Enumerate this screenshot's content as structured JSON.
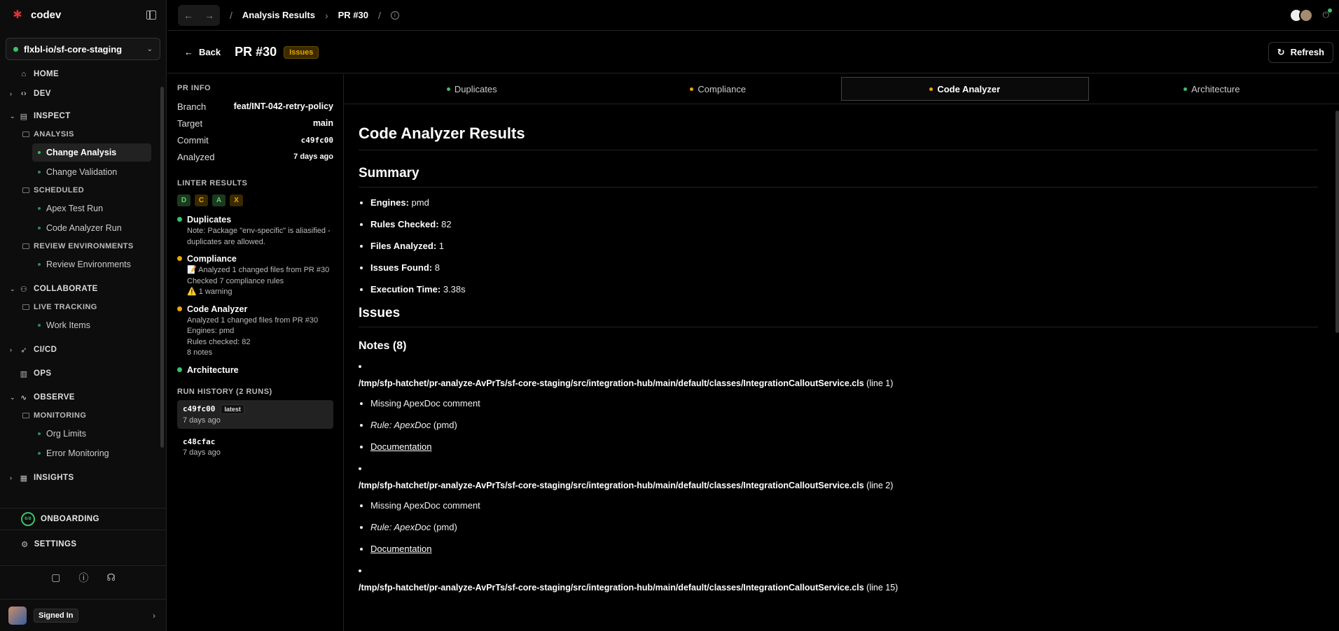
{
  "app": {
    "name": "codev"
  },
  "repo": {
    "name": "flxbl-io/sf-core-staging"
  },
  "nav": {
    "home": "HOME",
    "dev": "DEV",
    "inspect": "INSPECT",
    "analysis": "ANALYSIS",
    "change_analysis": "Change Analysis",
    "change_validation": "Change Validation",
    "scheduled": "SCHEDULED",
    "apex_test_run": "Apex Test Run",
    "code_analyzer_run": "Code Analyzer Run",
    "review_environments_group": "REVIEW ENVIRONMENTS",
    "review_environments": "Review Environments",
    "collaborate": "COLLABORATE",
    "live_tracking": "LIVE TRACKING",
    "work_items": "Work Items",
    "cicd": "CI/CD",
    "ops": "OPS",
    "observe": "OBSERVE",
    "monitoring": "MONITORING",
    "org_limits": "Org Limits",
    "error_monitoring": "Error Monitoring",
    "insights": "INSIGHTS",
    "onboarding": "ONBOARDING",
    "onboarding_progress": "6/8",
    "settings": "SETTINGS",
    "signed_in": "Signed In"
  },
  "breadcrumb": {
    "items": [
      "Analysis Results",
      "PR #30"
    ]
  },
  "header": {
    "back": "Back",
    "title": "PR #30",
    "badge": "Issues",
    "refresh": "Refresh"
  },
  "pr_info": {
    "heading": "PR INFO",
    "rows": [
      {
        "label": "Branch",
        "value": "feat/INT-042-retry-policy"
      },
      {
        "label": "Target",
        "value": "main"
      },
      {
        "label": "Commit",
        "value": "c49fc00"
      },
      {
        "label": "Analyzed",
        "value": "7 days ago"
      }
    ]
  },
  "linter": {
    "heading": "LINTER RESULTS",
    "badges": [
      "D",
      "C",
      "A",
      "X"
    ],
    "results": [
      {
        "title": "Duplicates",
        "status": "pass",
        "lines": [
          "Note: Package \"env-specific\" is aliasified - duplicates are allowed."
        ]
      },
      {
        "title": "Compliance",
        "status": "warn",
        "lines": [
          "📝 Analyzed 1 changed files from PR #30",
          "Checked 7 compliance rules",
          "⚠️ 1 warning"
        ]
      },
      {
        "title": "Code Analyzer",
        "status": "warn",
        "lines": [
          "Analyzed 1 changed files from PR #30",
          "Engines: pmd",
          "Rules checked: 82",
          "8 notes"
        ]
      },
      {
        "title": "Architecture",
        "status": "pass",
        "lines": []
      }
    ]
  },
  "run_history": {
    "heading": "RUN HISTORY (2 RUNS)",
    "runs": [
      {
        "commit": "c49fc00",
        "tag": "latest",
        "when": "7 days ago"
      },
      {
        "commit": "c48cfac",
        "tag": "",
        "when": "7 days ago"
      }
    ]
  },
  "tabs": [
    {
      "label": "Duplicates",
      "status": "pass"
    },
    {
      "label": "Compliance",
      "status": "warn"
    },
    {
      "label": "Code Analyzer",
      "status": "warn"
    },
    {
      "label": "Architecture",
      "status": "pass"
    }
  ],
  "results": {
    "title": "Code Analyzer Results",
    "summary_heading": "Summary",
    "summary": [
      {
        "label": "Engines:",
        "value": "pmd"
      },
      {
        "label": "Rules Checked:",
        "value": "82"
      },
      {
        "label": "Files Analyzed:",
        "value": "1"
      },
      {
        "label": "Issues Found:",
        "value": "8"
      },
      {
        "label": "Execution Time:",
        "value": "3.38s"
      }
    ],
    "issues_heading": "Issues",
    "notes_heading": "Notes (8)",
    "notes": [
      {
        "path": "/tmp/sfp-hatchet/pr-analyze-AvPrTs/sf-core-staging/src/integration-hub/main/default/classes/IntegrationCalloutService.cls",
        "line": "(line 1)",
        "message": "Missing ApexDoc comment",
        "rule_label": "Rule: ApexDoc",
        "engine": "(pmd)",
        "doc": "Documentation"
      },
      {
        "path": "/tmp/sfp-hatchet/pr-analyze-AvPrTs/sf-core-staging/src/integration-hub/main/default/classes/IntegrationCalloutService.cls",
        "line": "(line 2)",
        "message": "Missing ApexDoc comment",
        "rule_label": "Rule: ApexDoc",
        "engine": "(pmd)",
        "doc": "Documentation"
      },
      {
        "path": "/tmp/sfp-hatchet/pr-analyze-AvPrTs/sf-core-staging/src/integration-hub/main/default/classes/IntegrationCalloutService.cls",
        "line": "(line 15)",
        "message": "",
        "rule_label": "",
        "engine": "",
        "doc": ""
      }
    ]
  },
  "colors": {
    "accent_green": "#3ac26b",
    "accent_orange": "#f0a500",
    "background": "#000000"
  }
}
